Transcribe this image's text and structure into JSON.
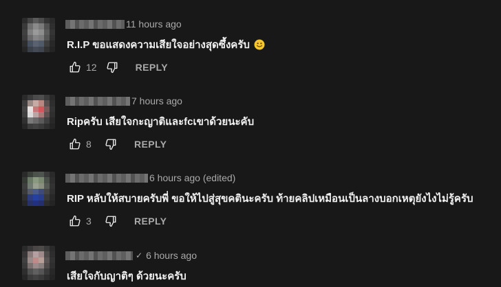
{
  "comments": [
    {
      "time": "11 hours ago",
      "text": "R.I.P ขอแสดงความเสียใจอย่างสุดซึ้งครับ",
      "emoji": "slightly-smiling-face-icon",
      "likes": "12",
      "reply": "REPLY"
    },
    {
      "time": "7 hours ago",
      "text": "Ripครับ เสียใจกะญาติและfcเขาด้วยนะคับ",
      "likes": "8",
      "reply": "REPLY"
    },
    {
      "time": "6 hours ago (edited)",
      "text": "RIP หลับให้สบายครับพี่ ขอให้ไปสู่สุขคตินะครับ ท้ายคลิปเหมือนเป็นลางบอกเหตุยังไงไม่รู้ครับ",
      "likes": "3",
      "reply": "REPLY"
    },
    {
      "time": "6 hours ago",
      "verified_mark": "✓",
      "text": "เสียใจกับญาติๆ ด้วยนะครับ"
    }
  ],
  "colors": {
    "background": "#181818",
    "text": "#f1f1f1",
    "secondary": "#aaaaaa"
  }
}
